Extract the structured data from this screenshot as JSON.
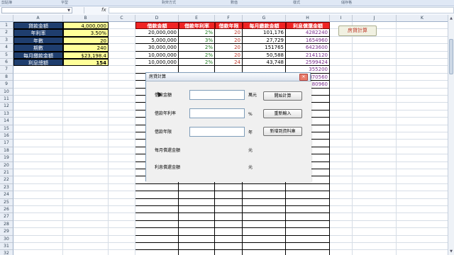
{
  "ribbon_groups": [
    "剪貼簿",
    "字型",
    "對齊方式",
    "數值",
    "樣式",
    "儲存格"
  ],
  "formula_bar": {
    "name_box": "",
    "fx": "fx"
  },
  "columns": [
    "A",
    "B",
    "C",
    "D",
    "E",
    "F",
    "G",
    "H",
    "I",
    "J",
    "K"
  ],
  "rows": [
    "1",
    "2",
    "3",
    "4",
    "5",
    "6",
    "7",
    "8",
    "9",
    "10",
    "11",
    "12",
    "13",
    "14",
    "15",
    "16",
    "17",
    "18",
    "19",
    "20",
    "21",
    "22",
    "23",
    "24",
    "25",
    "26",
    "27",
    "28",
    "29",
    "30",
    "31",
    "32"
  ],
  "params": [
    {
      "label": "貸款金額",
      "value": "4,000,000"
    },
    {
      "label": "年利率",
      "value": "3.50%"
    },
    {
      "label": "年數",
      "value": "20"
    },
    {
      "label": "期數",
      "value": "240"
    },
    {
      "label": "每月繳款金額",
      "value": "$23,198.4"
    },
    {
      "label": "利息總額",
      "value": "154"
    }
  ],
  "table": {
    "headers": [
      "借款金額",
      "借款年利率",
      "借款年限",
      "每月繳款金額",
      "利息償還金額"
    ],
    "rows": [
      [
        "20,000,000",
        "2%",
        "20",
        "101,176",
        "4282240"
      ],
      [
        "5,000,000",
        "3%",
        "20",
        "27,729",
        "1654960"
      ],
      [
        "30,000,000",
        "2%",
        "20",
        "151765",
        "6423600"
      ],
      [
        "10,000,000",
        "2%",
        "20",
        "50,588",
        "2141120"
      ],
      [
        "10,000,000",
        "2%",
        "24",
        "43,748",
        "2599424"
      ],
      [
        "",
        "",
        "",
        "",
        "355200"
      ],
      [
        "",
        "",
        "",
        "",
        "070560"
      ],
      [
        "",
        "",
        "",
        "",
        "580960"
      ]
    ]
  },
  "sheet_button": "房貸計算",
  "dialog": {
    "title": "房貸計算",
    "labels": {
      "amount": "借款金額",
      "rate": "借款年利率",
      "years": "借款年限",
      "monthly": "每月償還金額",
      "interest": "利息償還金額"
    },
    "units": {
      "amount": "萬元",
      "rate": "%",
      "years": "年",
      "monthly": "元",
      "interest": "元"
    },
    "buttons": {
      "calc": "開始計算",
      "reset": "重新輸入",
      "add": "新增到資料庫"
    },
    "close": "✕"
  }
}
